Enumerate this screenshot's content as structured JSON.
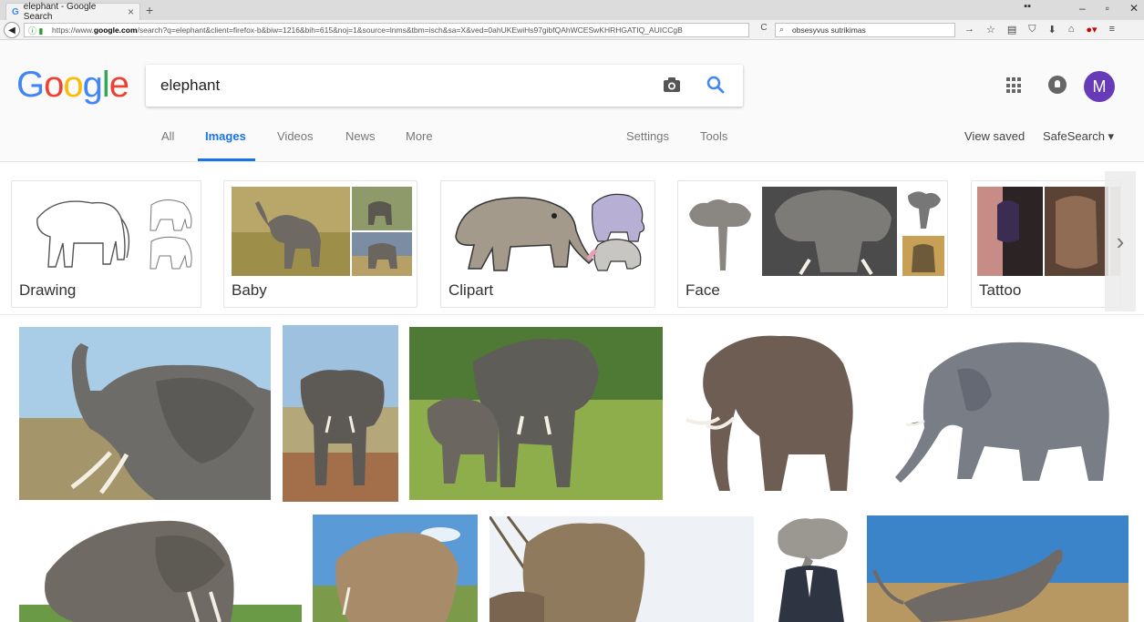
{
  "browser": {
    "tab_title": "elephant - Google Search",
    "tab_close": "×",
    "new_tab": "+",
    "url_prefix": "https://www.",
    "url_domain": "google.com",
    "url_rest": "/search?q=elephant&client=firefox-b&biw=1216&bih=615&noj=1&source=lnms&tbm=isch&sa=X&ved=0ahUKEwiHs97gibfQAhWCESwKHRHGATIQ_AUICCgB",
    "search_bar_text": "obsesyvus sutrikimas",
    "window_controls": [
      "–",
      "▫",
      "✕"
    ]
  },
  "google": {
    "logo_letters": [
      "G",
      "o",
      "o",
      "g",
      "l",
      "e"
    ],
    "query": "elephant",
    "avatar_letter": "M",
    "nav_tabs": [
      {
        "label": "All"
      },
      {
        "label": "Images"
      },
      {
        "label": "Videos"
      },
      {
        "label": "News"
      },
      {
        "label": "More"
      },
      {
        "label": "Settings"
      },
      {
        "label": "Tools"
      }
    ],
    "view_saved": "View saved",
    "safesearch": "SafeSearch ▾"
  },
  "related_searches": [
    "Drawing",
    "Baby",
    "Clipart",
    "Face",
    "Tattoo"
  ],
  "colors": {
    "accent": "#1a73e8",
    "avatar": "#673ab7"
  }
}
